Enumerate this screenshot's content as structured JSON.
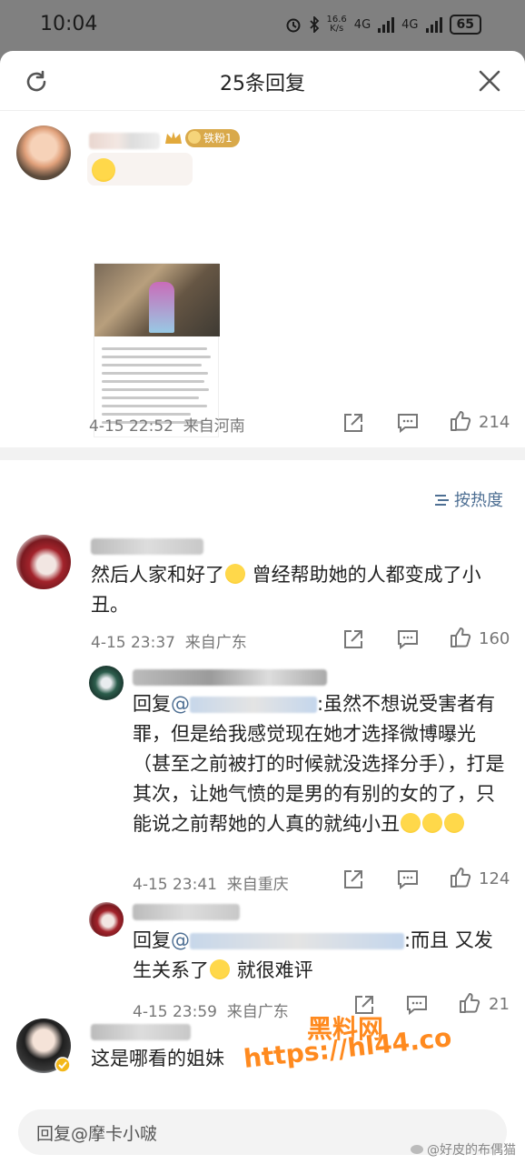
{
  "status_bar": {
    "time": "10:04",
    "speed_value": "16.6",
    "speed_unit": "K/s",
    "network_1": "4G",
    "network_2": "4G",
    "battery": "65"
  },
  "sheet": {
    "title": "25条回复"
  },
  "root_comment": {
    "badge": "铁粉1",
    "date": "4-15 22:52",
    "location": "来自河南",
    "likes": "214"
  },
  "sort_label": "按热度",
  "comments": [
    {
      "text_a": "然后人家和好了",
      "text_b": " 曾经帮助她的人都变成了小丑。",
      "date": "4-15 23:37",
      "location": "来自广东",
      "likes": "160"
    },
    {
      "reply_prefix": "回复",
      "mention": "@",
      "text": ":虽然不想说受害者有罪，但是给我感觉现在她才选择微博曝光（甚至之前被打的时候就没选择分手），打是其次，让她气愤的是男的有别的女的了，只能说之前帮她的人真的就纯小丑",
      "date": "4-15 23:41",
      "location": "来自重庆",
      "likes": "124"
    },
    {
      "reply_prefix": "回复",
      "mention": "@",
      "text_a": ":而且 又发生关系了",
      "text_b": " 就很难评",
      "date": "4-15 23:59",
      "location": "来自广东",
      "likes": "21"
    },
    {
      "text": "这是哪看的姐妹"
    }
  ],
  "reply_input": {
    "placeholder": "回复@摩卡小啵"
  },
  "watermarks": {
    "site_name": "黑料网",
    "site_url": "https://hl44.co",
    "footer": "@好皮的布偶猫"
  },
  "colors": {
    "link": "#4e6f93",
    "accent_watermark": "#ff8a1f",
    "badge": "#d9a94a"
  }
}
